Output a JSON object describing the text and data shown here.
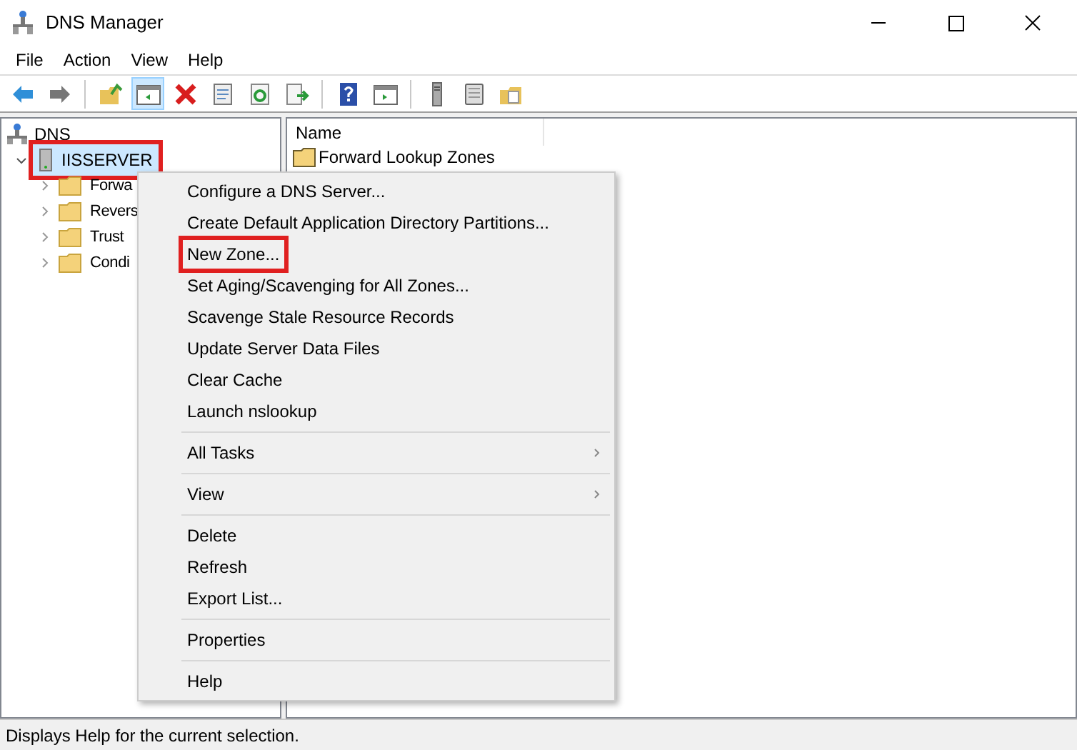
{
  "window": {
    "title": "DNS Manager"
  },
  "menu_bar": [
    "File",
    "Action",
    "View",
    "Help"
  ],
  "toolbar": [
    {
      "kind": "back",
      "pressed": false
    },
    {
      "kind": "forward",
      "pressed": false
    },
    {
      "kind": "separator"
    },
    {
      "kind": "up",
      "pressed": false
    },
    {
      "kind": "tree",
      "pressed": true
    },
    {
      "kind": "delete",
      "pressed": false
    },
    {
      "kind": "properties",
      "pressed": false
    },
    {
      "kind": "refresh",
      "pressed": false
    },
    {
      "kind": "export",
      "pressed": false
    },
    {
      "kind": "separator"
    },
    {
      "kind": "help",
      "pressed": false
    },
    {
      "kind": "pane",
      "pressed": false
    },
    {
      "kind": "separator"
    },
    {
      "kind": "server",
      "pressed": false
    },
    {
      "kind": "panel",
      "pressed": false
    },
    {
      "kind": "folderdoc",
      "pressed": false
    }
  ],
  "tree": {
    "label": "DNS",
    "children": [
      {
        "label": "IISSERVER",
        "expanded": true,
        "selected": true,
        "highlighted": true,
        "children": [
          {
            "label": "Forwa",
            "expanded": false
          },
          {
            "label": "Revers",
            "expanded": false
          },
          {
            "label": "Trust",
            "expanded": false
          },
          {
            "label": "Condi",
            "expanded": false
          }
        ]
      }
    ]
  },
  "list": {
    "columns": [
      "Name"
    ],
    "rows": [
      "Forward Lookup Zones"
    ]
  },
  "context_menu": [
    [
      {
        "label": "Configure a DNS Server...",
        "submenu": false,
        "highlighted": false
      },
      {
        "label": "Create Default Application Directory Partitions...",
        "submenu": false,
        "highlighted": false
      },
      {
        "label": "New Zone...",
        "submenu": false,
        "highlighted": true
      },
      {
        "label": "Set Aging/Scavenging for All Zones...",
        "submenu": false,
        "highlighted": false
      },
      {
        "label": "Scavenge Stale Resource Records",
        "submenu": false,
        "highlighted": false
      },
      {
        "label": "Update Server Data Files",
        "submenu": false,
        "highlighted": false
      },
      {
        "label": "Clear Cache",
        "submenu": false,
        "highlighted": false
      },
      {
        "label": "Launch nslookup",
        "submenu": false,
        "highlighted": false
      }
    ],
    [
      {
        "label": "All Tasks",
        "submenu": true,
        "highlighted": false
      }
    ],
    [
      {
        "label": "View",
        "submenu": true,
        "highlighted": false
      }
    ],
    [
      {
        "label": "Delete",
        "submenu": false,
        "highlighted": false
      },
      {
        "label": "Refresh",
        "submenu": false,
        "highlighted": false
      },
      {
        "label": "Export List...",
        "submenu": false,
        "highlighted": false
      }
    ],
    [
      {
        "label": "Properties",
        "submenu": false,
        "highlighted": false
      }
    ],
    [
      {
        "label": "Help",
        "submenu": false,
        "highlighted": false
      }
    ]
  ],
  "status_bar": "Displays Help for the current selection."
}
